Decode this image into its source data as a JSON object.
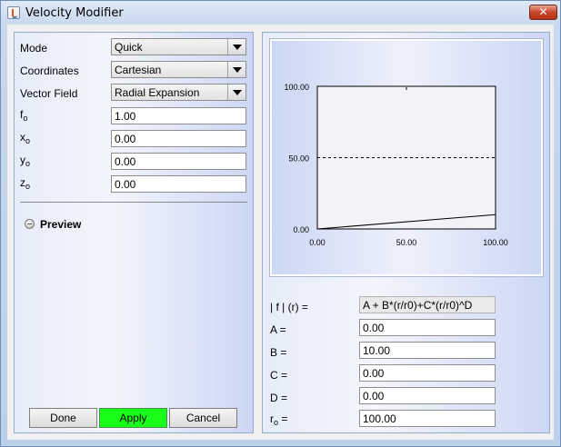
{
  "window": {
    "title": "Velocity Modifier",
    "close_glyph": "✕"
  },
  "params": {
    "mode_label": "Mode",
    "mode_value": "Quick",
    "coordinates_label": "Coordinates",
    "coordinates_value": "Cartesian",
    "vector_field_label": "Vector Field",
    "vector_field_value": "Radial Expansion",
    "f0_label": "f",
    "f0_sub": "o",
    "f0_value": "1.00",
    "x0_label": "x",
    "x0_sub": "o",
    "x0_value": "0.00",
    "y0_label": "y",
    "y0_sub": "o",
    "y0_value": "0.00",
    "z0_label": "z",
    "z0_sub": "o",
    "z0_value": "0.00"
  },
  "preview": {
    "label": "Preview"
  },
  "buttons": {
    "done": "Done",
    "apply": "Apply",
    "cancel": "Cancel"
  },
  "formula": {
    "lhs_label": "| f | (r) =",
    "expression": "A + B*(r/r0)+C*(r/r0)^D",
    "a_label": "A =",
    "a_value": "0.00",
    "b_label": "B =",
    "b_value": "10.00",
    "c_label": "C =",
    "c_value": "0.00",
    "d_label": "D =",
    "d_value": "0.00",
    "r0_label": "r",
    "r0_sub": "o",
    "r0_eq": "=",
    "r0_value": "100.00"
  },
  "chart_data": {
    "type": "line",
    "title": "",
    "xlabel": "",
    "ylabel": "",
    "xlim": [
      0,
      100
    ],
    "ylim": [
      0,
      100
    ],
    "x_ticks": [
      "0.00",
      "50.00",
      "100.00"
    ],
    "y_ticks": [
      "0.00",
      "50.00",
      "100.00"
    ],
    "series": [
      {
        "x": [
          0,
          100
        ],
        "y": [
          0,
          10
        ]
      }
    ],
    "reference_line_y": 50,
    "colors": {
      "plot_bg": "#f3f2f9",
      "line": "#000000"
    }
  }
}
